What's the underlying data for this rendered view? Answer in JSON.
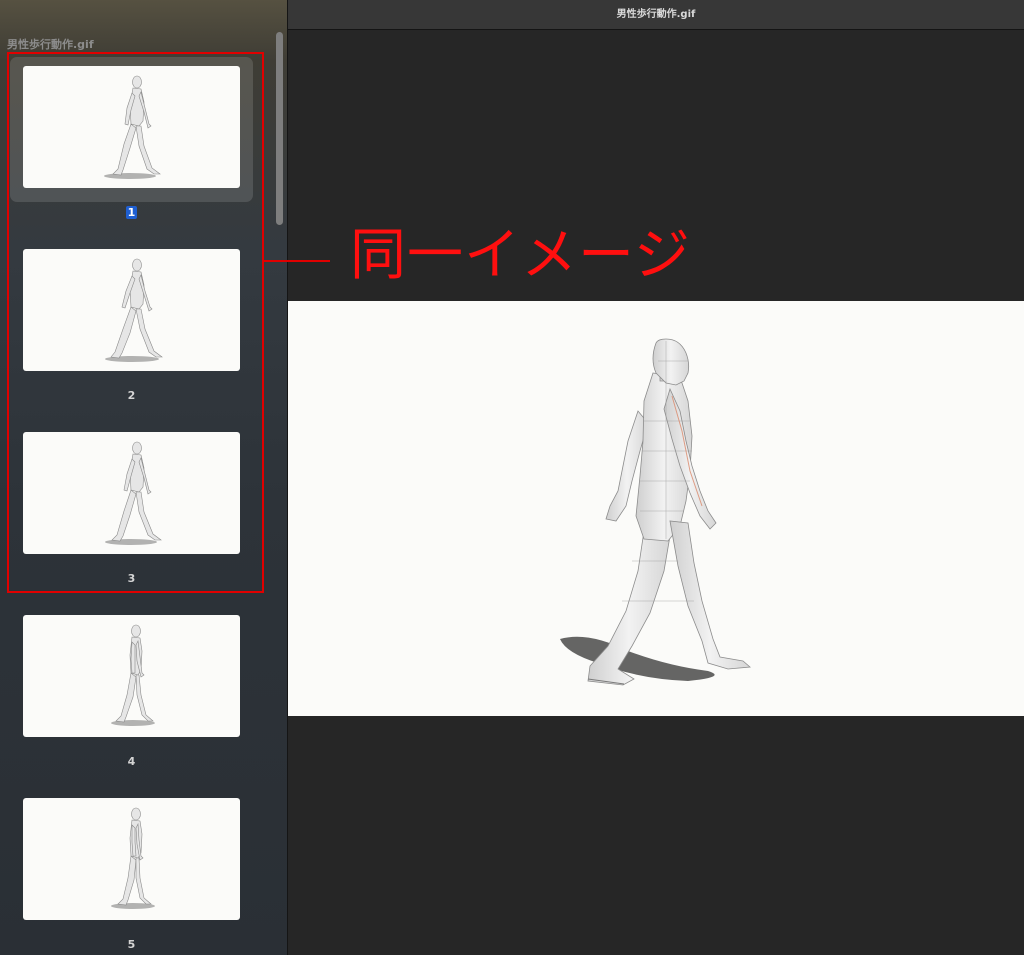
{
  "window": {
    "title": "男性歩行動作.gif"
  },
  "sidebar": {
    "document_title": "男性歩行動作.gif",
    "selected_index": 0,
    "pages": [
      {
        "number": "1",
        "selected": true
      },
      {
        "number": "2",
        "selected": false
      },
      {
        "number": "3",
        "selected": false
      },
      {
        "number": "4",
        "selected": false
      },
      {
        "number": "5",
        "selected": false
      }
    ]
  },
  "annotation": {
    "label": "同一イメージ",
    "color": "#e10000"
  },
  "colors": {
    "sidebar_bg": "#2d3339",
    "main_bg": "#262626",
    "selection_badge": "#1f5fd1",
    "image_bg": "#fbfbf9"
  }
}
